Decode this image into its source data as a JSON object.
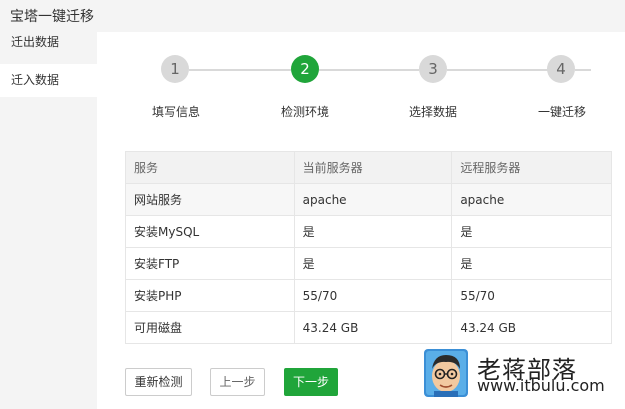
{
  "app": {
    "title": "宝塔一键迁移"
  },
  "sidebar": {
    "items": [
      {
        "label": "迁出数据"
      },
      {
        "label": "迁入数据"
      }
    ]
  },
  "steps": [
    {
      "number": "1",
      "label": "填写信息",
      "active": false
    },
    {
      "number": "2",
      "label": "检测环境",
      "active": true
    },
    {
      "number": "3",
      "label": "选择数据",
      "active": false
    },
    {
      "number": "4",
      "label": "一键迁移",
      "active": false
    }
  ],
  "table": {
    "headers": [
      "服务",
      "当前服务器",
      "远程服务器"
    ],
    "rows": [
      [
        "网站服务",
        "apache",
        "apache"
      ],
      [
        "安装MySQL",
        "是",
        "是"
      ],
      [
        "安装FTP",
        "是",
        "是"
      ],
      [
        "安装PHP",
        "55/70",
        "55/70"
      ],
      [
        "可用磁盘",
        "43.24 GB",
        "43.24 GB"
      ]
    ]
  },
  "buttons": {
    "recheck": "重新检测",
    "prev": "上一步",
    "next": "下一步"
  },
  "watermark": {
    "title": "老蒋部落",
    "url": "www.itbulu.com"
  },
  "colors": {
    "accent": "#20a53a",
    "step_inactive": "#d9d9d9",
    "sidebar_bg": "#f4f4f4"
  }
}
